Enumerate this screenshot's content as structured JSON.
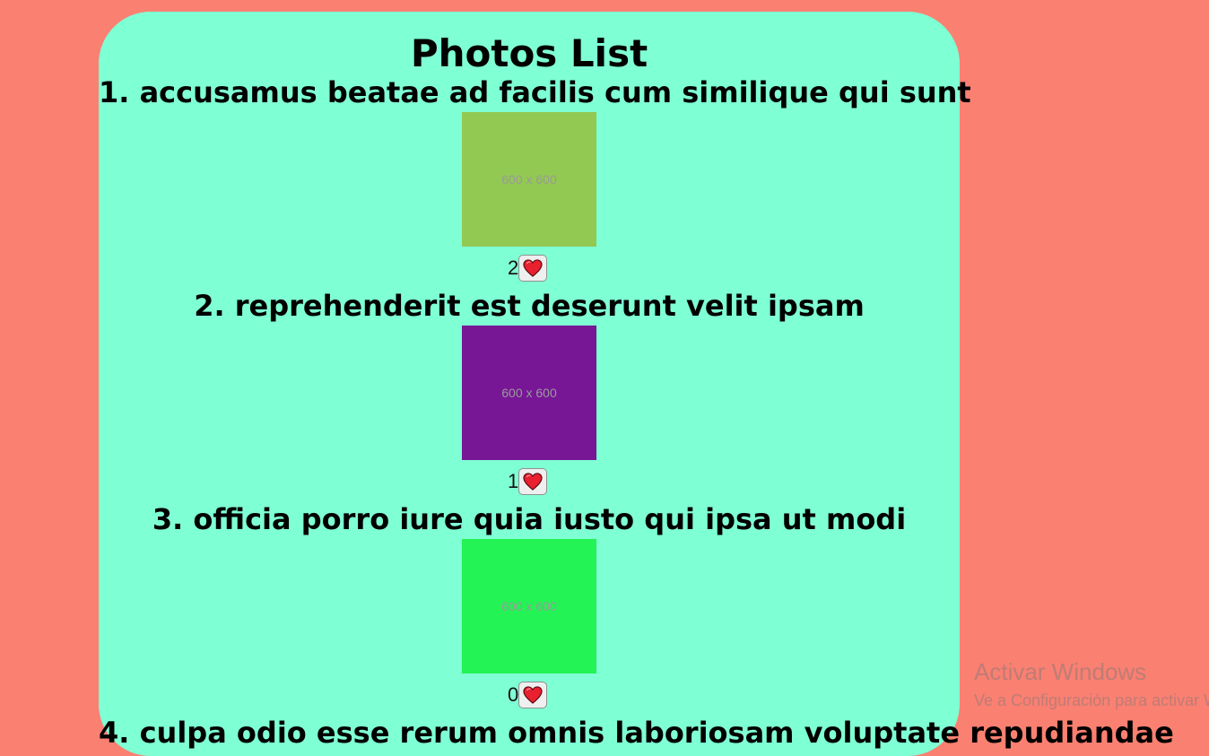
{
  "page": {
    "title": "Photos List",
    "background_color": "#fa8072",
    "card_color": "#7fffd4"
  },
  "photos": [
    {
      "title": "1. accusamus beatae ad facilis cum similique qui sunt",
      "thumbnail_text": "600 x 600",
      "thumbnail_color": "#92c952",
      "likes": "2",
      "like_icon": "heart-icon"
    },
    {
      "title": "2. reprehenderit est deserunt velit ipsam",
      "thumbnail_text": "600 x 600",
      "thumbnail_color": "#771796",
      "likes": "1",
      "like_icon": "heart-icon"
    },
    {
      "title": "3. officia porro iure quia iusto qui ipsa ut modi",
      "thumbnail_text": "600 x 600",
      "thumbnail_color": "#24f355",
      "likes": "0",
      "like_icon": "heart-icon"
    },
    {
      "title": "4. culpa odio esse rerum omnis laboriosam voluptate repudiandae"
    }
  ],
  "os_watermark": {
    "title": "Activar Windows",
    "subtitle": "Ve a Configuración para activar Windows."
  }
}
